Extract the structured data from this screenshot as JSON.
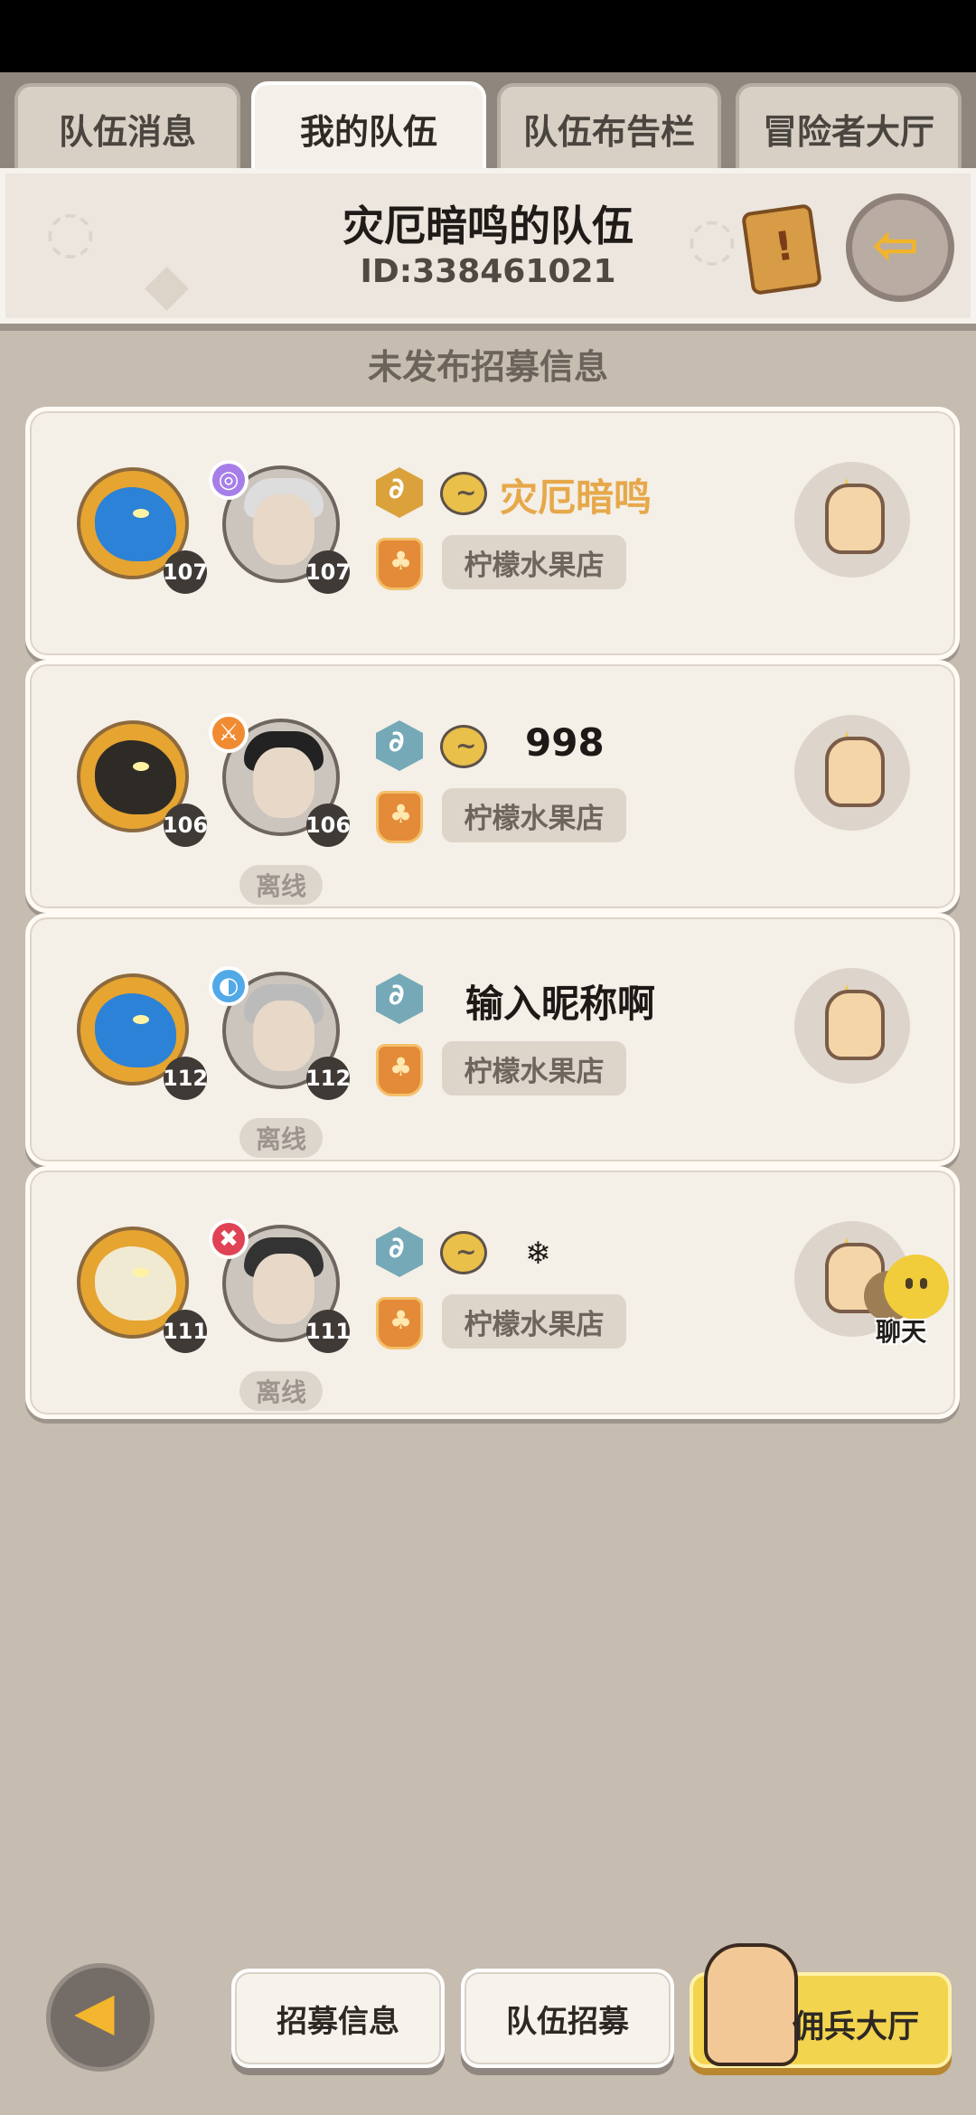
{
  "tabs": [
    {
      "label": "队伍消息"
    },
    {
      "label": "我的队伍",
      "active": true
    },
    {
      "label": "队伍布告栏"
    },
    {
      "label": "冒险者大厅"
    }
  ],
  "team": {
    "title": "灾厄暗鸣的队伍",
    "id": "ID:338461021"
  },
  "recruit_status": "未发布招募信息",
  "members": [
    {
      "pet_level": "107",
      "player_level": "107",
      "name": "灾厄暗鸣",
      "guild": "柠檬水果店",
      "offline": ""
    },
    {
      "pet_level": "106",
      "player_level": "106",
      "name": "998",
      "guild": "柠檬水果店",
      "offline": "离线"
    },
    {
      "pet_level": "112",
      "player_level": "112",
      "name": "输入昵称啊",
      "guild": "柠檬水果店",
      "offline": "离线"
    },
    {
      "pet_level": "111",
      "player_level": "111",
      "name": "❄",
      "guild": "柠檬水果店",
      "offline": "离线"
    }
  ],
  "chat_label": "聊天",
  "bottom": {
    "recruit_info": "招募信息",
    "team_recruit": "队伍招募",
    "mercenary_hall": "佣兵大厅"
  },
  "colors": {
    "leader_name": "#e6a84a",
    "accent_gold": "#f3d44f",
    "background": "#c6bcb0"
  }
}
